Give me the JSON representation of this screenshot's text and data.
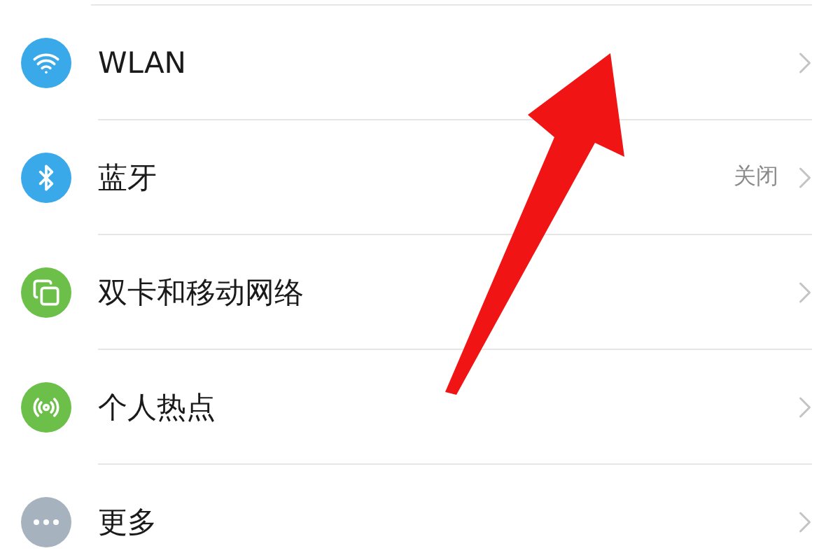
{
  "settings_rows": [
    {
      "kind": "wifi",
      "label": "WLAN",
      "color": "#3aa9ea"
    },
    {
      "kind": "bluetooth",
      "label": "蓝牙",
      "value": "关闭",
      "color": "#3aa9ea"
    },
    {
      "kind": "sim",
      "label": "双卡和移动网络",
      "color": "#6cc04a"
    },
    {
      "kind": "hotspot",
      "label": "个人热点",
      "color": "#6cc04a"
    },
    {
      "kind": "more",
      "label": "更多",
      "color": "#a6b2bd"
    }
  ]
}
